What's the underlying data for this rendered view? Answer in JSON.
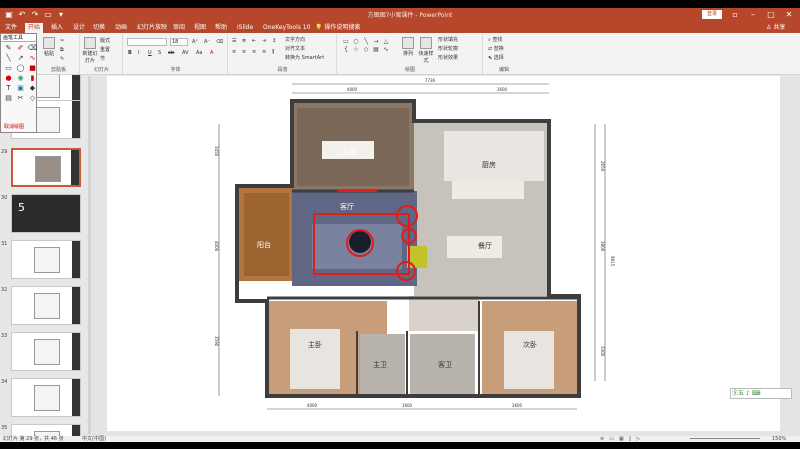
{
  "titlebar": {
    "document_title": "方图图7小案课件 - PowerPoint",
    "login_label": "登录",
    "qat_icons": [
      "save-icon",
      "undo-icon",
      "redo-icon",
      "present-icon",
      "dropdown-icon"
    ]
  },
  "tabs": [
    "文件",
    "开始",
    "插入",
    "设计",
    "切换",
    "动画",
    "幻灯片放映",
    "审阅",
    "视图",
    "帮助",
    "iSlide",
    "OneKeyTools 10",
    "操作说明搜索"
  ],
  "active_tab": "开始",
  "share_label": "共享",
  "ribbon": {
    "groups": {
      "clipboard": "剪贴板",
      "slides": "幻灯片",
      "font": "字体",
      "paragraph": "段落",
      "drawing": "绘图",
      "editing": "编辑"
    },
    "paste_label": "粘贴",
    "new_slide_label": "新建幻灯片",
    "layout_label": "版式",
    "reset_label": "重置",
    "section_label": "节",
    "convert_smartart": "转换为 SmartArt",
    "text_direction": "文字方向",
    "align_text": "对齐文本",
    "arrange_label": "排列",
    "quick_styles_label": "快速样式",
    "shape_fill": "形状填充",
    "shape_outline": "形状轮廓",
    "shape_effects": "形状效果",
    "find_label": "查找",
    "replace_label": "替换",
    "select_label": "选择",
    "font_size_value": "18"
  },
  "draw_panel": {
    "title": "画笔工具",
    "cancel_label": "取消绘图"
  },
  "thumbnails": [
    {
      "number": "",
      "kind": "plan"
    },
    {
      "number": "",
      "kind": "plan"
    },
    {
      "number": "29",
      "kind": "plan-selected"
    },
    {
      "number": "30",
      "kind": "title",
      "text": "5"
    },
    {
      "number": "31",
      "kind": "plan"
    },
    {
      "number": "32",
      "kind": "plan"
    },
    {
      "number": "33",
      "kind": "plan"
    },
    {
      "number": "34",
      "kind": "plan"
    },
    {
      "number": "35",
      "kind": "plan"
    }
  ],
  "floorplan": {
    "rooms": {
      "tea_room": "品茗",
      "living_room": "客厅",
      "kitchen": "厨房",
      "dining_room": "餐厅",
      "balcony": "阳台",
      "master_bedroom": "主卧",
      "master_bath": "主卫",
      "guest_bath": "客卫",
      "second_bedroom": "次卧"
    },
    "dimensions": {
      "top_total": "7736",
      "top_left": "4000",
      "top_right": "3600",
      "right_total": "9815",
      "right_upper": "2650",
      "right_middle": "3800",
      "right_lower": "3300",
      "left_upper": "3450",
      "left_middle": "4000",
      "left_lower": "3590",
      "bottom_a": "4000",
      "bottom_b": "3600",
      "bottom_c": "1600"
    }
  },
  "wps_logo_text": "五",
  "statusbar": {
    "slide_info": "幻灯片 第 29 张，共 46 张",
    "language": "中文(中国)",
    "zoom": "150%"
  }
}
